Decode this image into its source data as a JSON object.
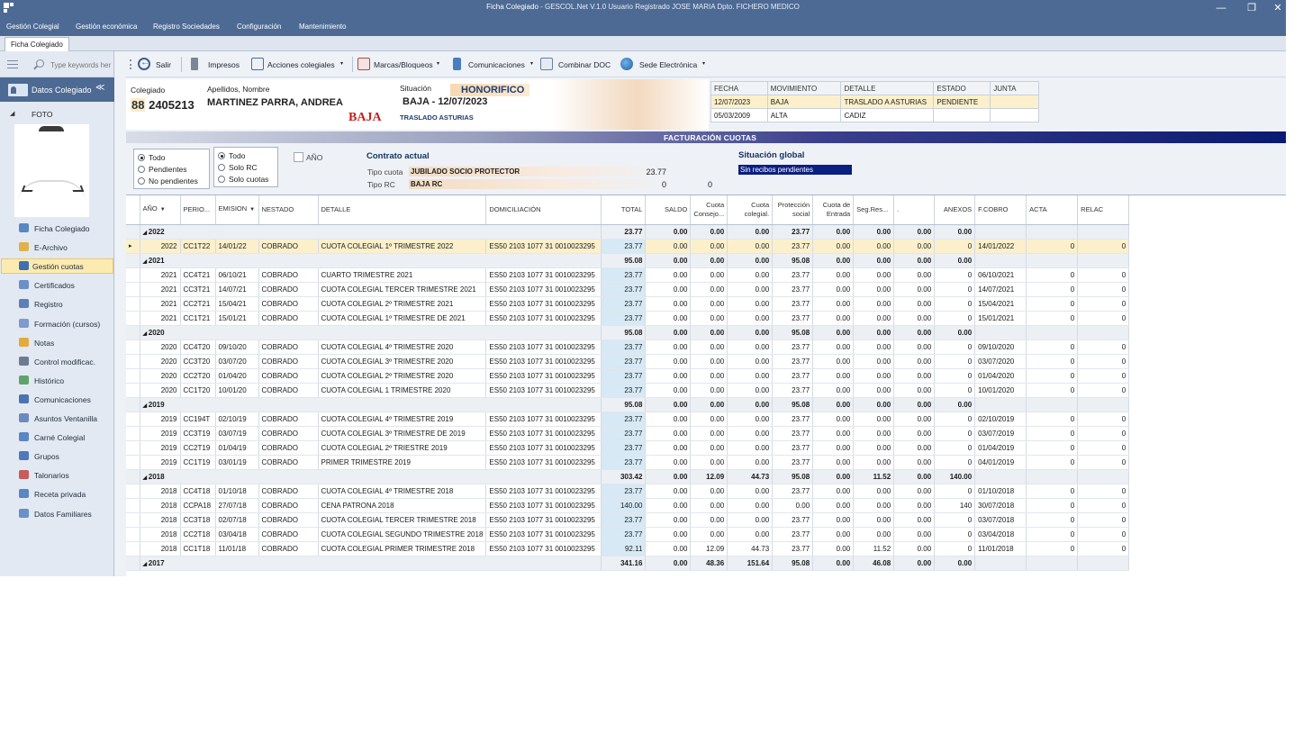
{
  "window": {
    "title_main": "Ficha Colegiado",
    "title_rest": " - GESCOL.Net V.1.0  Usuario Registrado JOSE MARIA  Dpto. FICHERO MEDICO",
    "minimize": "—",
    "restore": "❐",
    "close": "✕"
  },
  "menu": [
    "Gestión Colegial",
    "Gestión económica",
    "Registro Sociedades",
    "Configuración",
    "Mantenimiento"
  ],
  "doc_tab": "Ficha Colegiado",
  "nav": {
    "search_placeholder": "Type keywords her",
    "header": "Datos Colegiado",
    "header_caret": "≪",
    "foto_label": "FOTO",
    "items": [
      {
        "label": "Ficha Colegiado",
        "icon": "user-card-icon",
        "color": "#5a86c4"
      },
      {
        "label": "E-Archivo",
        "icon": "folder-icon",
        "color": "#e0b34a"
      },
      {
        "label": "Gestión cuotas",
        "icon": "table-icon",
        "color": "#3f6fb3",
        "active": true
      },
      {
        "label": "Certificados",
        "icon": "certificate-icon",
        "color": "#6a8fc9"
      },
      {
        "label": "Registro",
        "icon": "register-icon",
        "color": "#5b7fb8"
      },
      {
        "label": "Formación (cursos)",
        "icon": "training-icon",
        "color": "#7d9bd0"
      },
      {
        "label": "Notas",
        "icon": "notes-icon",
        "color": "#e3a93b"
      },
      {
        "label": "Control modificac.",
        "icon": "search-control-icon",
        "color": "#6c7b92"
      },
      {
        "label": "Histórico",
        "icon": "history-icon",
        "color": "#5fa36a"
      },
      {
        "label": "Comunicaciones",
        "icon": "phone-icon",
        "color": "#4b73b0"
      },
      {
        "label": "Asuntos Ventanilla",
        "icon": "people-icon",
        "color": "#6b8ac0"
      },
      {
        "label": "Carné Colegial",
        "icon": "id-card-icon",
        "color": "#5a86c4"
      },
      {
        "label": "Grupos",
        "icon": "groups-icon",
        "color": "#4e78bb"
      },
      {
        "label": "Talonarios",
        "icon": "pen-icon",
        "color": "#c85b5b"
      },
      {
        "label": "Receta privada",
        "icon": "prescription-icon",
        "color": "#5a86c4"
      },
      {
        "label": "Datos Familiares",
        "icon": "family-icon",
        "color": "#6a8fc9"
      }
    ]
  },
  "toolbar": {
    "salir": "Salir",
    "impresos": "Impresos",
    "acciones": "Acciones colegiales",
    "marcas": "Marcas/Bloqueos",
    "comunicaciones": "Comunicaciones",
    "combinar": "Combinar DOC",
    "sede": "Sede Electrónica",
    "dropdown_glyph": "▾"
  },
  "member": {
    "colegiado_label": "Colegiado",
    "prefix": "88",
    "number": "2405213",
    "name_label": "Apellidos, Nombre",
    "name": "MARTINEZ PARRA, ANDREA",
    "baja_flag": "BAJA",
    "situacion_label": "Situación",
    "situacion_badge": "HONORIFICO",
    "situacion": "BAJA - 12/07/2023",
    "motivo": "TRASLADO ASTURIAS"
  },
  "movements": {
    "headers": [
      "FECHA",
      "MOVIMIENTO",
      "DETALLE",
      "ESTADO",
      "JUNTA"
    ],
    "rows": [
      [
        "12/07/2023",
        "BAJA",
        "TRASLADO A ASTURIAS",
        "PENDIENTE",
        ""
      ],
      [
        "05/03/2009",
        "ALTA",
        "CADIZ",
        "",
        ""
      ]
    ]
  },
  "facturacion_title": "FACTURACIÓN CUOTAS",
  "filters": {
    "group1": [
      "Todo",
      "Pendientes",
      "No pendientes"
    ],
    "group2": [
      "Todo",
      "Solo RC",
      "Solo cuotas"
    ],
    "anio_label": "AÑO",
    "contrato_title": "Contrato actual",
    "tipo_cuota_label": "Tipo cuota",
    "tipo_cuota_value": "JUBILADO SOCIO PROTECTOR",
    "tipo_cuota_amount": "23.77",
    "tipo_rc_label": "Tipo RC",
    "tipo_rc_value": "BAJA RC",
    "tipo_rc_amount1": "0",
    "tipo_rc_amount2": "0",
    "situacion_global_title": "Situación global",
    "situacion_global_value": "Sin recibos pendientes"
  },
  "grid": {
    "headers": [
      "AÑO",
      "PERIO...",
      "EMISION",
      "NESTADO",
      "DETALLE",
      "DOMICILIACIÓN",
      "TOTAL",
      "SALDO",
      "Cuota Consejo...",
      "Cuota colegial.",
      "Protección social",
      "Cuota de Entrada",
      "Seg.Res...",
      ".",
      "ANEXOS",
      "F.COBRO",
      "ACTA",
      "RELAC"
    ],
    "rows": [
      {
        "type": "group",
        "year": "2022",
        "totals": [
          "23.77",
          "0.00",
          "0.00",
          "0.00",
          "23.77",
          "0.00",
          "0.00",
          "0.00",
          "0.00"
        ]
      },
      {
        "type": "data",
        "selected": true,
        "cells": [
          "2022",
          "CC1T22",
          "14/01/22",
          "COBRADO",
          "CUOTA COLEGIAL 1º TRIMESTRE 2022",
          "ES50 2103 1077 31 0010023295",
          "23.77",
          "0.00",
          "0.00",
          "0.00",
          "23.77",
          "0.00",
          "0.00",
          "0.00",
          "0",
          "14/01/2022",
          "0",
          "0"
        ]
      },
      {
        "type": "group",
        "year": "2021",
        "totals": [
          "95.08",
          "0.00",
          "0.00",
          "0.00",
          "95.08",
          "0.00",
          "0.00",
          "0.00",
          "0.00"
        ]
      },
      {
        "type": "data",
        "cells": [
          "2021",
          "CC4T21",
          "06/10/21",
          "COBRADO",
          "CUARTO TRIMESTRE 2021",
          "ES50 2103 1077 31 0010023295",
          "23.77",
          "0.00",
          "0.00",
          "0.00",
          "23.77",
          "0.00",
          "0.00",
          "0.00",
          "0",
          "06/10/2021",
          "0",
          "0"
        ]
      },
      {
        "type": "data",
        "cells": [
          "2021",
          "CC3T21",
          "14/07/21",
          "COBRADO",
          "CUOTA COLEGIAL TERCER TRIMESTRE 2021",
          "ES50 2103 1077 31 0010023295",
          "23.77",
          "0.00",
          "0.00",
          "0.00",
          "23.77",
          "0.00",
          "0.00",
          "0.00",
          "0",
          "14/07/2021",
          "0",
          "0"
        ]
      },
      {
        "type": "data",
        "cells": [
          "2021",
          "CC2T21",
          "15/04/21",
          "COBRADO",
          "CUOTA COLEGIAL 2º TRIMESTRE 2021",
          "ES50 2103 1077 31 0010023295",
          "23.77",
          "0.00",
          "0.00",
          "0.00",
          "23.77",
          "0.00",
          "0.00",
          "0.00",
          "0",
          "15/04/2021",
          "0",
          "0"
        ]
      },
      {
        "type": "data",
        "cells": [
          "2021",
          "CC1T21",
          "15/01/21",
          "COBRADO",
          "CUOTA COLEGIAL 1º TRIMESTRE DE 2021",
          "ES50 2103 1077 31 0010023295",
          "23.77",
          "0.00",
          "0.00",
          "0.00",
          "23.77",
          "0.00",
          "0.00",
          "0.00",
          "0",
          "15/01/2021",
          "0",
          "0"
        ]
      },
      {
        "type": "group",
        "year": "2020",
        "totals": [
          "95.08",
          "0.00",
          "0.00",
          "0.00",
          "95.08",
          "0.00",
          "0.00",
          "0.00",
          "0.00"
        ]
      },
      {
        "type": "data",
        "cells": [
          "2020",
          "CC4T20",
          "09/10/20",
          "COBRADO",
          "CUOTA COLEGIAL 4º TRIMESTRE 2020",
          "ES50 2103 1077 31 0010023295",
          "23.77",
          "0.00",
          "0.00",
          "0.00",
          "23.77",
          "0.00",
          "0.00",
          "0.00",
          "0",
          "09/10/2020",
          "0",
          "0"
        ]
      },
      {
        "type": "data",
        "cells": [
          "2020",
          "CC3T20",
          "03/07/20",
          "COBRADO",
          "CUOTA COLEGIAL 3º TRIMESTRE 2020",
          "ES50 2103 1077 31 0010023295",
          "23.77",
          "0.00",
          "0.00",
          "0.00",
          "23.77",
          "0.00",
          "0.00",
          "0.00",
          "0",
          "03/07/2020",
          "0",
          "0"
        ]
      },
      {
        "type": "data",
        "cells": [
          "2020",
          "CC2T20",
          "01/04/20",
          "COBRADO",
          "CUOTA COLEGIAL 2º TRIMESTRE 2020",
          "ES50 2103 1077 31 0010023295",
          "23.77",
          "0.00",
          "0.00",
          "0.00",
          "23.77",
          "0.00",
          "0.00",
          "0.00",
          "0",
          "01/04/2020",
          "0",
          "0"
        ]
      },
      {
        "type": "data",
        "cells": [
          "2020",
          "CC1T20",
          "10/01/20",
          "COBRADO",
          "CUOTA COLEGIAL 1 TRIMESTRE 2020",
          "ES50 2103 1077 31 0010023295",
          "23.77",
          "0.00",
          "0.00",
          "0.00",
          "23.77",
          "0.00",
          "0.00",
          "0.00",
          "0",
          "10/01/2020",
          "0",
          "0"
        ]
      },
      {
        "type": "group",
        "year": "2019",
        "totals": [
          "95.08",
          "0.00",
          "0.00",
          "0.00",
          "95.08",
          "0.00",
          "0.00",
          "0.00",
          "0.00"
        ]
      },
      {
        "type": "data",
        "cells": [
          "2019",
          "CC194T",
          "02/10/19",
          "COBRADO",
          "CUOTA COLEGIAL 4º TRIMESTRE 2019",
          "ES50 2103 1077 31 0010023295",
          "23.77",
          "0.00",
          "0.00",
          "0.00",
          "23.77",
          "0.00",
          "0.00",
          "0.00",
          "0",
          "02/10/2019",
          "0",
          "0"
        ]
      },
      {
        "type": "data",
        "cells": [
          "2019",
          "CC3T19",
          "03/07/19",
          "COBRADO",
          "CUOTA COLEGIAL 3º TRIMESTRE DE 2019",
          "ES50 2103 1077 31 0010023295",
          "23.77",
          "0.00",
          "0.00",
          "0.00",
          "23.77",
          "0.00",
          "0.00",
          "0.00",
          "0",
          "03/07/2019",
          "0",
          "0"
        ]
      },
      {
        "type": "data",
        "cells": [
          "2019",
          "CC2T19",
          "01/04/19",
          "COBRADO",
          "CUOTA COLEGIAL 2º TRIESTRE 2019",
          "ES50 2103 1077 31 0010023295",
          "23.77",
          "0.00",
          "0.00",
          "0.00",
          "23.77",
          "0.00",
          "0.00",
          "0.00",
          "0",
          "01/04/2019",
          "0",
          "0"
        ]
      },
      {
        "type": "data",
        "cells": [
          "2019",
          "CC1T19",
          "03/01/19",
          "COBRADO",
          "PRIMER TRIMESTRE 2019",
          "ES50 2103 1077 31 0010023295",
          "23.77",
          "0.00",
          "0.00",
          "0.00",
          "23.77",
          "0.00",
          "0.00",
          "0.00",
          "0",
          "04/01/2019",
          "0",
          "0"
        ]
      },
      {
        "type": "group",
        "year": "2018",
        "totals": [
          "303.42",
          "0.00",
          "12.09",
          "44.73",
          "95.08",
          "0.00",
          "11.52",
          "0.00",
          "140.00"
        ]
      },
      {
        "type": "data",
        "cells": [
          "2018",
          "CC4T18",
          "01/10/18",
          "COBRADO",
          "CUOTA COLEGIAL 4º TRIMESTRE 2018",
          "ES50 2103 1077 31 0010023295",
          "23.77",
          "0.00",
          "0.00",
          "0.00",
          "23.77",
          "0.00",
          "0.00",
          "0.00",
          "0",
          "01/10/2018",
          "0",
          "0"
        ]
      },
      {
        "type": "data",
        "cells": [
          "2018",
          "CCPA18",
          "27/07/18",
          "COBRADO",
          "CENA PATRONA 2018",
          "ES50 2103 1077 31 0010023295",
          "140.00",
          "0.00",
          "0.00",
          "0.00",
          "0.00",
          "0.00",
          "0.00",
          "0.00",
          "140",
          "30/07/2018",
          "0",
          "0"
        ]
      },
      {
        "type": "data",
        "cells": [
          "2018",
          "CC3T18",
          "02/07/18",
          "COBRADO",
          "CUOTA COLEGIAL TERCER TRIMESTRE 2018",
          "ES50 2103 1077 31 0010023295",
          "23.77",
          "0.00",
          "0.00",
          "0.00",
          "23.77",
          "0.00",
          "0.00",
          "0.00",
          "0",
          "03/07/2018",
          "0",
          "0"
        ]
      },
      {
        "type": "data",
        "cells": [
          "2018",
          "CC2T18",
          "03/04/18",
          "COBRADO",
          "CUOTA COLEGIAL SEGUNDO TRIMESTRE 2018",
          "ES50 2103 1077 31 0010023295",
          "23.77",
          "0.00",
          "0.00",
          "0.00",
          "23.77",
          "0.00",
          "0.00",
          "0.00",
          "0",
          "03/04/2018",
          "0",
          "0"
        ]
      },
      {
        "type": "data",
        "cells": [
          "2018",
          "CC1T18",
          "11/01/18",
          "COBRADO",
          "CUOTA COLEGIAL PRIMER TRIMESTRE 2018",
          "ES50 2103 1077 31 0010023295",
          "92.11",
          "0.00",
          "12.09",
          "44.73",
          "23.77",
          "0.00",
          "11.52",
          "0.00",
          "0",
          "11/01/2018",
          "0",
          "0"
        ]
      },
      {
        "type": "group",
        "year": "2017",
        "totals": [
          "341.16",
          "0.00",
          "48.36",
          "151.64",
          "95.08",
          "0.00",
          "46.08",
          "0.00",
          "0.00"
        ]
      }
    ]
  },
  "colors": {
    "title_bar": "#4d6a94",
    "active_nav": "#fcebb0",
    "baja_red": "#c81e1e",
    "band_dark": "#0a1a70",
    "total_cell": "#d6e9f4"
  }
}
